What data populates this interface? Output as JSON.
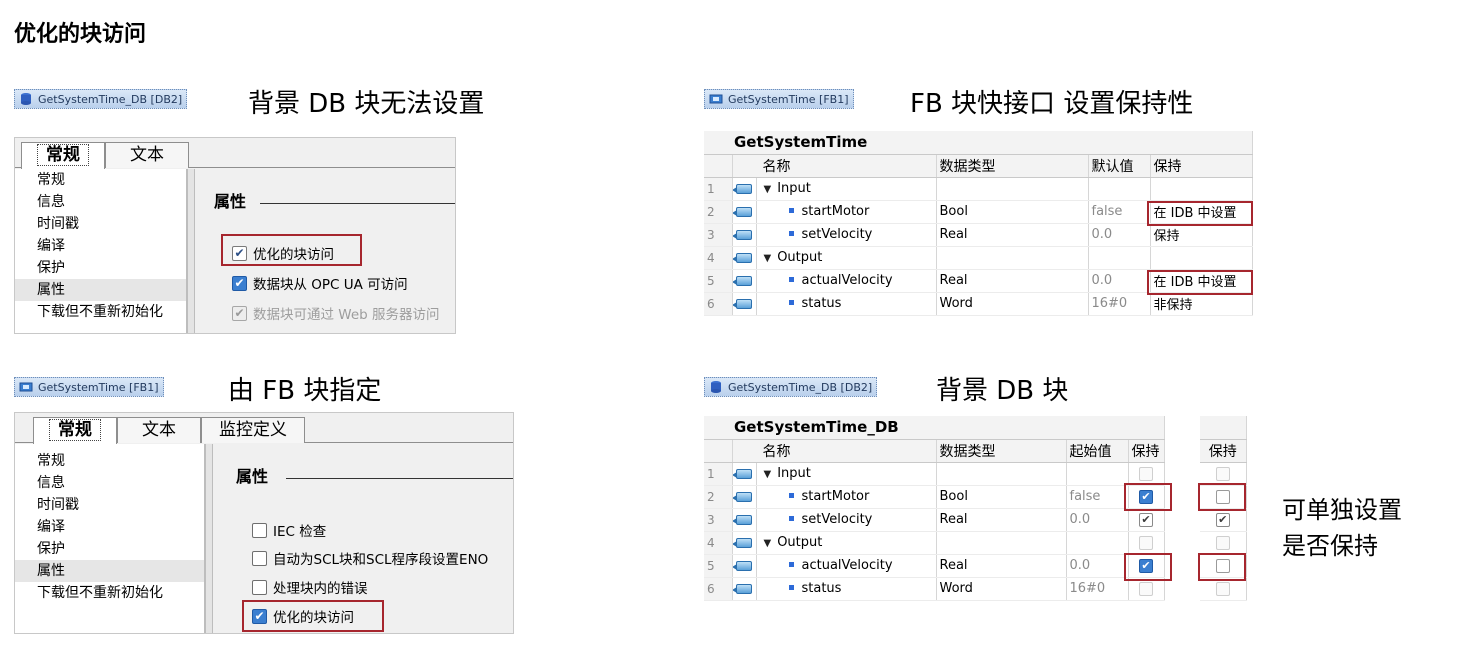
{
  "page_title": "优化的块访问",
  "panel_a": {
    "tag_label": "GetSystemTime_DB [DB2]",
    "caption": "背景 DB 块无法设置",
    "tabs": [
      "常规",
      "文本"
    ],
    "nav": [
      "常规",
      "信息",
      "时间戳",
      "编译",
      "保护",
      "属性",
      "下载但不重新初始化"
    ],
    "selected_nav": "属性",
    "section_title": "属性",
    "options": [
      {
        "label": "优化的块访问",
        "checked": true,
        "style": "plain"
      },
      {
        "label": "数据块从 OPC UA 可访问",
        "checked": true,
        "style": "blue"
      },
      {
        "label": "数据块可通过 Web 服务器访问",
        "checked": true,
        "style": "disabled"
      }
    ]
  },
  "panel_b": {
    "tag_label": "GetSystemTime [FB1]",
    "caption": "由 FB 块指定",
    "tabs": [
      "常规",
      "文本",
      "监控定义"
    ],
    "nav": [
      "常规",
      "信息",
      "时间戳",
      "编译",
      "保护",
      "属性",
      "下载但不重新初始化"
    ],
    "selected_nav": "属性",
    "section_title": "属性",
    "options": [
      {
        "label": "IEC 检查",
        "checked": false
      },
      {
        "label": "自动为SCL块和SCL程序段设置ENO",
        "checked": false
      },
      {
        "label": "处理块内的错误",
        "checked": false
      },
      {
        "label": "优化的块访问",
        "checked": true
      }
    ]
  },
  "panel_c": {
    "tag_label": "GetSystemTime [FB1]",
    "caption": "FB 块快接口 设置保持性",
    "block_name": "GetSystemTime",
    "headers": [
      "名称",
      "数据类型",
      "默认值",
      "保持"
    ],
    "rows": [
      {
        "no": "1",
        "kind": "section",
        "name": "Input",
        "type": "",
        "default": "",
        "retain": ""
      },
      {
        "no": "2",
        "kind": "var",
        "name": "startMotor",
        "type": "Bool",
        "default": "false",
        "retain": "在 IDB 中设置"
      },
      {
        "no": "3",
        "kind": "var",
        "name": "setVelocity",
        "type": "Real",
        "default": "0.0",
        "retain": "保持"
      },
      {
        "no": "4",
        "kind": "section",
        "name": "Output",
        "type": "",
        "default": "",
        "retain": ""
      },
      {
        "no": "5",
        "kind": "var",
        "name": "actualVelocity",
        "type": "Real",
        "default": "0.0",
        "retain": "在 IDB 中设置"
      },
      {
        "no": "6",
        "kind": "var",
        "name": "status",
        "type": "Word",
        "default": "16#0",
        "retain": "非保持"
      }
    ]
  },
  "panel_d": {
    "tag_label": "GetSystemTime_DB [DB2]",
    "caption": "背景 DB 块",
    "block_name": "GetSystemTime_DB",
    "headers": [
      "名称",
      "数据类型",
      "起始值",
      "保持"
    ],
    "extra_header": "保持",
    "rows": [
      {
        "no": "1",
        "kind": "section",
        "name": "Input",
        "type": "",
        "start": "",
        "retain": "none",
        "retain2": "none"
      },
      {
        "no": "2",
        "kind": "var",
        "name": "startMotor",
        "type": "Bool",
        "start": "false",
        "retain": "blue",
        "retain2": "off"
      },
      {
        "no": "3",
        "kind": "var",
        "name": "setVelocity",
        "type": "Real",
        "start": "0.0",
        "retain": "plain",
        "retain2": "plain"
      },
      {
        "no": "4",
        "kind": "section",
        "name": "Output",
        "type": "",
        "start": "",
        "retain": "none",
        "retain2": "none"
      },
      {
        "no": "5",
        "kind": "var",
        "name": "actualVelocity",
        "type": "Real",
        "start": "0.0",
        "retain": "blue",
        "retain2": "off"
      },
      {
        "no": "6",
        "kind": "var",
        "name": "status",
        "type": "Word",
        "start": "16#0",
        "retain": "none",
        "retain2": "none"
      }
    ],
    "note_line1": "可单独设置",
    "note_line2": "是否保持"
  },
  "colors": {
    "highlight_box": "#a6262e",
    "check_blue": "#3b7fd0",
    "tag_bg": "#c9dcf2"
  }
}
